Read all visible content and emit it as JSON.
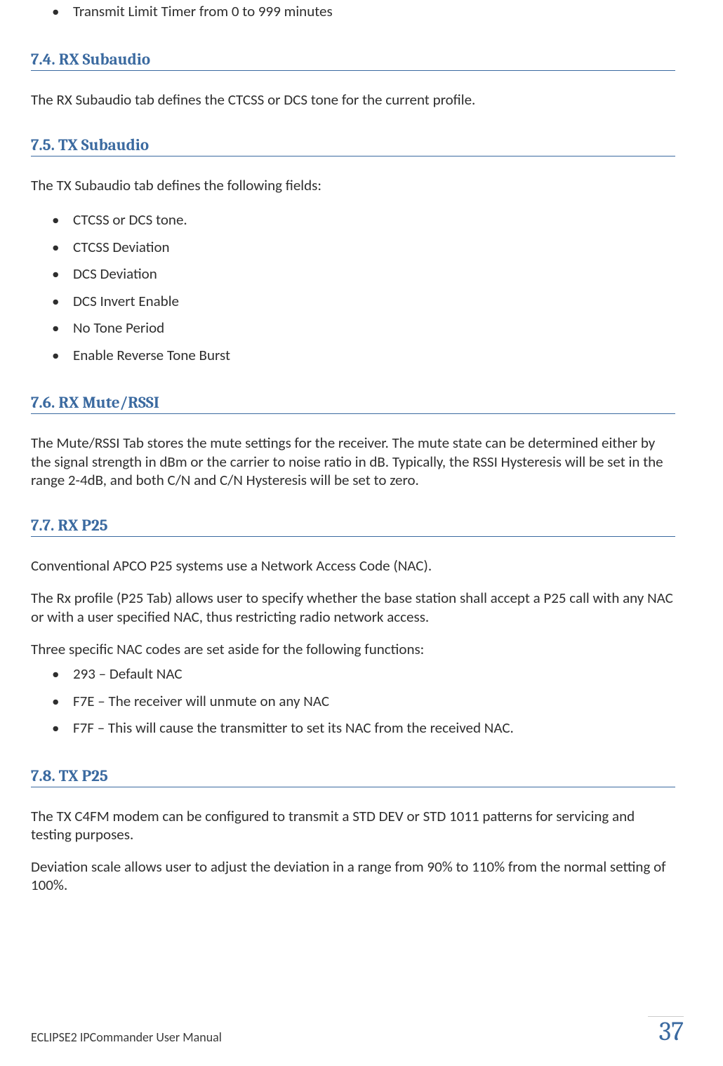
{
  "top_list": [
    "Transmit Limit Timer from 0 to 999 minutes"
  ],
  "s74": {
    "heading": "7.4. RX Subaudio",
    "p1": "The RX Subaudio tab defines the CTCSS or DCS tone for the current profile."
  },
  "s75": {
    "heading": "7.5. TX Subaudio",
    "p1": "The TX Subaudio tab defines the following fields:",
    "items": [
      "CTCSS or DCS tone.",
      "CTCSS Deviation",
      "DCS Deviation",
      "DCS Invert Enable",
      "No Tone Period",
      "Enable Reverse Tone Burst"
    ]
  },
  "s76": {
    "heading": "7.6. RX Mute/RSSI",
    "p1": "The Mute/RSSI Tab stores the mute settings for the receiver. The mute state can be determined either by the signal strength in dBm or the carrier to noise ratio in dB.  Typically, the RSSI Hysteresis will be set in the range 2-4dB, and both C/N and C/N Hysteresis will be set to zero."
  },
  "s77": {
    "heading": "7.7. RX P25",
    "p1": "Conventional APCO P25 systems use a Network Access Code (NAC).",
    "p2": "The Rx profile (P25 Tab) allows user to specify whether the base station shall accept a P25 call with any NAC or with a user specified NAC, thus restricting radio network access.",
    "p3": "Three specific NAC codes are set aside for the following functions:",
    "items": [
      "293 – Default NAC",
      "F7E – The receiver will unmute on any NAC",
      "F7F – This will cause the transmitter to set its NAC from the received NAC."
    ]
  },
  "s78": {
    "heading": "7.8. TX P25",
    "p1": "The TX C4FM modem can be configured to transmit a STD DEV or STD 1011 patterns for servicing and testing purposes.",
    "p2": "Deviation scale allows user to adjust the deviation in a range from 90% to 110% from the normal setting of 100%."
  },
  "footer": {
    "left": "ECLIPSE2 IPCommander User Manual",
    "page": "37"
  }
}
